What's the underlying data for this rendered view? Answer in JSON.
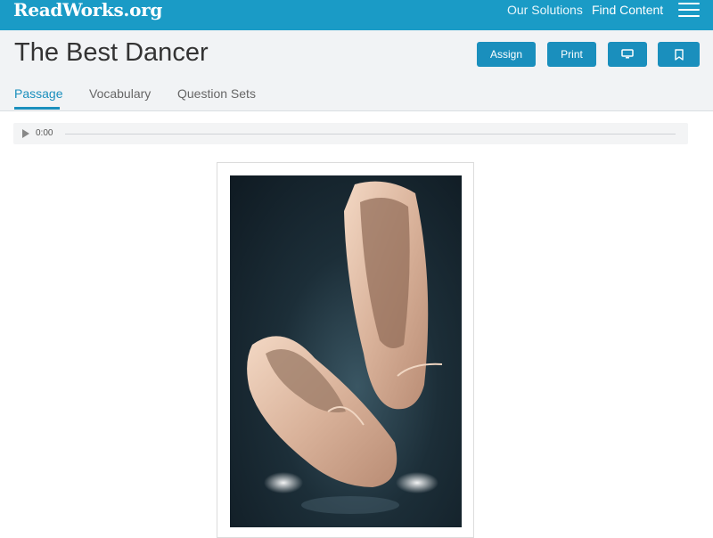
{
  "header": {
    "logo": "ReadWorks.org",
    "nav": {
      "solutions": "Our Solutions",
      "find_content": "Find Content"
    }
  },
  "page": {
    "title": "The Best Dancer",
    "buttons": {
      "assign": "Assign",
      "print": "Print"
    },
    "tabs": [
      "Passage",
      "Vocabulary",
      "Question Sets"
    ],
    "active_tab": "Passage"
  },
  "audio": {
    "time": "0:00"
  },
  "image": {
    "subject": "pair of worn satin pointe ballet shoes"
  },
  "colors": {
    "brand": "#1a9bc6",
    "button": "#1a8fbd"
  }
}
